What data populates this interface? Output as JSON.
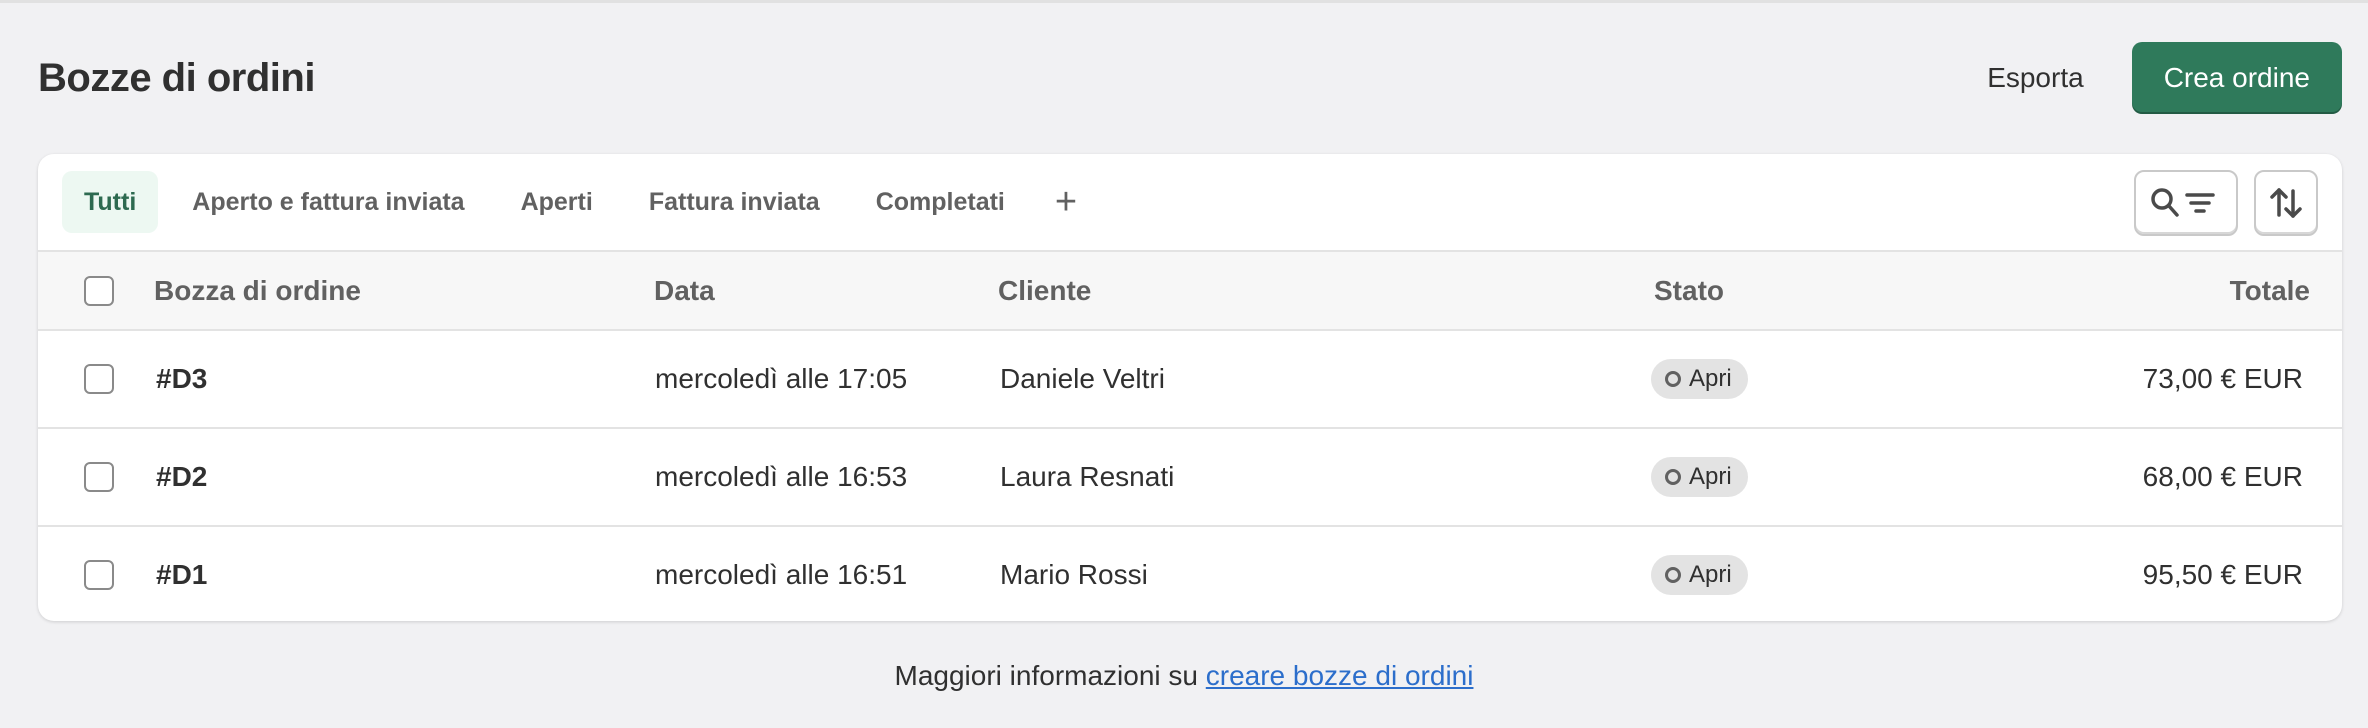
{
  "header": {
    "title": "Bozze di ordini",
    "export_label": "Esporta",
    "create_label": "Crea ordine"
  },
  "tabs": [
    {
      "label": "Tutti",
      "active": true
    },
    {
      "label": "Aperto e fattura inviata"
    },
    {
      "label": "Aperti"
    },
    {
      "label": "Fattura inviata"
    },
    {
      "label": "Completati"
    }
  ],
  "tab_add_glyph": "+",
  "toolbar": {
    "search_filter_icon": "search-filter-icon",
    "sort_icon": "sort-icon"
  },
  "table": {
    "columns": {
      "order": "Bozza di ordine",
      "date": "Data",
      "customer": "Cliente",
      "status": "Stato",
      "total": "Totale"
    },
    "rows": [
      {
        "order": "#D3",
        "date": "mercoledì alle 17:05",
        "customer": "Daniele Veltri",
        "status": "Apri",
        "total": "73,00 € EUR"
      },
      {
        "order": "#D2",
        "date": "mercoledì alle 16:53",
        "customer": "Laura Resnati",
        "status": "Apri",
        "total": "68,00 € EUR"
      },
      {
        "order": "#D1",
        "date": "mercoledì alle 16:51",
        "customer": "Mario Rossi",
        "status": "Apri",
        "total": "95,50 € EUR"
      }
    ]
  },
  "footer": {
    "text": "Maggiori informazioni su ",
    "link": "creare bozze di ordini"
  },
  "colors": {
    "primary": "#2f7a5b",
    "background": "#f1f1f3",
    "link": "#2c6ecb"
  }
}
